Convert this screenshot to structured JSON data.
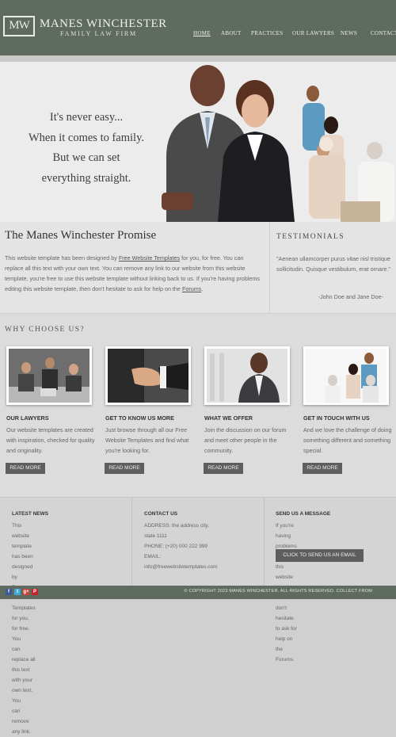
{
  "header": {
    "logo_mark": "MW",
    "logo_name": "MANES WINCHESTER",
    "logo_sub": "FAMILY LAW FIRM",
    "nav": [
      "HOME",
      "ABOUT",
      "PRACTICES",
      "OUR LAWYERS",
      "NEWS",
      "CONTACT"
    ]
  },
  "banner": {
    "lines": [
      "It's never easy...",
      "When it comes to family.",
      "But we can set",
      "everything straight."
    ]
  },
  "promise": {
    "title": "The Manes Winchester Promise",
    "text_1": "This website template has been designed by ",
    "link_1": "Free Website Templates",
    "text_2": " for you, for free. You can replace all this text with your own text. You can remove any link to our website from this website template, you're free to use this website template without linking back to us. If you're having problems editing this website template, then don't hesitate to ask for help on the ",
    "link_2": "Forums",
    "text_3": "."
  },
  "testimonials": {
    "title": "TESTIMONIALS",
    "quote": "\"Aenean ullamcorper purus vitae nisl tristique sollicitudin. Quisque vestibulum, erat ornare.\"",
    "author": "-John Doe and Jane Doe-"
  },
  "why": {
    "title": "WHY CHOOSE US?",
    "cards": [
      {
        "title": "OUR LAWYERS",
        "text": "Our website templates are created with inspiration, checked for quality and originality.",
        "button": "READ MORE",
        "icon": "lawyers-meeting-photo"
      },
      {
        "title": "GET TO KNOW US MORE",
        "text": "Just browse through all our Free Website Templates and find what you're looking for.",
        "button": "READ MORE",
        "icon": "handshake-photo"
      },
      {
        "title": "WHAT WE OFFER",
        "text": "Join the discussion on our forum and meet other people in the community.",
        "button": "READ MORE",
        "icon": "lawyer-portrait-photo"
      },
      {
        "title": "GET IN TOUCH WITH US",
        "text": "And we love the challenge of doing something different and something special.",
        "button": "READ MORE",
        "icon": "family-photo"
      }
    ]
  },
  "footer": {
    "latest_news": {
      "title": "LATEST NEWS",
      "lines": [
        "This website template has been designed by",
        "Free Website Templates for you, for free. You",
        "can replace all this text with your own text. You",
        "can remove any link."
      ]
    },
    "contact": {
      "title": "CONTACT US",
      "lines": [
        "ADDRESS: the address city, state 1111",
        "PHONE: (+20) 000 222 999",
        "EMAIL: info@freewebsitetemplates.com"
      ]
    },
    "message": {
      "title": "SEND US A MESSAGE",
      "lines": [
        "If you're having problems editing this website",
        "template, then don't hesitate to ask for help on",
        "the Forums."
      ],
      "button": "CLICK TO SEND US AN EMAIL"
    }
  },
  "bottom": {
    "copyright": "© COPYRIGHT 2023 MANES WINCHESTER. ALL RIGHTS RESERVED. COLLECT FROM",
    "social": [
      "f",
      "t",
      "g+",
      "P"
    ]
  },
  "colors": {
    "header": "#5f6b5e",
    "button": "#5e5e5e"
  }
}
